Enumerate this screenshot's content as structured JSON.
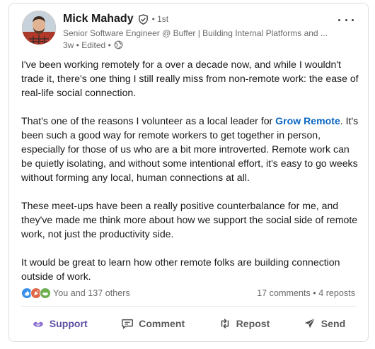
{
  "author": {
    "name": "Mick Mahady",
    "degree": "• 1st",
    "headline": "Senior Software Engineer @ Buffer | Building Internal Platforms and ...",
    "timestamp": "3w • Edited •"
  },
  "post": {
    "p1": "I've been working remotely for a over a decade now, and while I wouldn't trade it, there's one thing I still really miss from non-remote work: the ease of real-life social connection.",
    "p2_before": "That's one of the reasons I volunteer as a local leader for ",
    "p2_mention": "Grow Remote",
    "p2_after": ". It's been such a good way for remote workers to get together in person, especially for those of us who are a bit more introverted. Remote work can be quietly isolating, and without some intentional effort, it's easy to go weeks without forming any local, human connections at all.",
    "p3": "These meet-ups have been a really positive counterbalance for me, and they've made me think more about how we support the social side of remote work, not just the productivity side.",
    "p4": "It would be great to learn how other remote folks are building connection outside of work."
  },
  "social": {
    "reactions_text": "You and 137 others",
    "comments": "17 comments",
    "separator": " • ",
    "reposts": "4 reposts"
  },
  "actions": {
    "support": "Support",
    "comment": "Comment",
    "repost": "Repost",
    "send": "Send"
  },
  "colors": {
    "link": "#0a66c2",
    "support_active": "#5f4fa3"
  },
  "icons": [
    "verified-shield-icon",
    "globe-icon",
    "more-options-icon",
    "like-reaction-icon",
    "celebrate-reaction-icon",
    "support-reaction-icon",
    "support-icon",
    "comment-icon",
    "repost-icon",
    "send-icon"
  ]
}
